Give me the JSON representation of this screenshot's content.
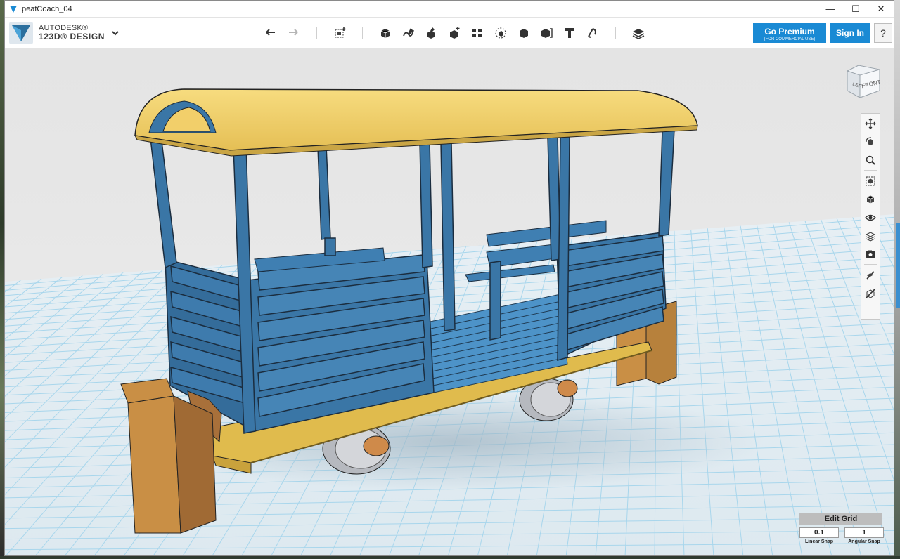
{
  "window": {
    "title": "peatCoach_04",
    "controls": {
      "minimize": "—",
      "maximize": "☐",
      "close": "✕"
    }
  },
  "brand": {
    "line1": "AUTODESK®",
    "line2": "123D® DESIGN",
    "logo_icon": "autodesk-123d-logo-icon",
    "menu_icon": "chevron-down-icon"
  },
  "toolbar": {
    "undo_icon": "undo-icon",
    "redo_icon": "redo-icon",
    "tools": [
      "transform-icon",
      "primitives-icon",
      "sketch-icon",
      "construct-icon",
      "modify-icon",
      "pattern-icon",
      "group-icon",
      "combine-icon",
      "measure-icon",
      "text-icon",
      "snap-icon",
      "material-icon"
    ],
    "premium_label": "Go Premium",
    "premium_sub": "(FOR COMMERCIAL USE)",
    "signin_label": "Sign In",
    "help_label": "?"
  },
  "viewcube": {
    "left_label": "LEFT",
    "front_label": "FRONT"
  },
  "navigation": [
    "pan-icon",
    "orbit-icon",
    "zoom-icon",
    "fit-icon",
    "views-icon",
    "visibility-icon",
    "materials-outline-icon",
    "screenshot-icon",
    "snap-tool-icon",
    "visual-style-icon"
  ],
  "grid": {
    "title": "Edit Grid",
    "linear_snap": "0.1",
    "angular_snap": "1",
    "linear_label": "Linear Snap",
    "angular_label": "Angular Snap"
  },
  "colors": {
    "accent": "#1a8ad4",
    "coach_body": "#3a76a6",
    "roof": "#f2cf6a",
    "chassis": "#d9b64a",
    "buffer_beam": "#c8843e",
    "grid_line": "#9fd2ea"
  }
}
